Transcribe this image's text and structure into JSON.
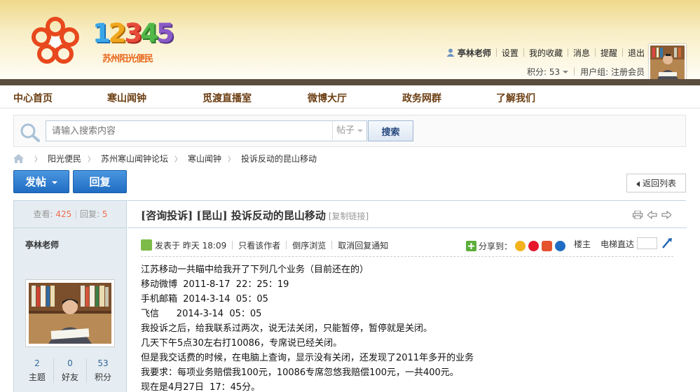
{
  "header": {
    "logo_number": "12345",
    "logo_subtitle": "苏州阳光便民",
    "user": {
      "name": "亭林老师",
      "links": [
        "设置",
        "我的收藏",
        "消息",
        "提醒",
        "退出"
      ],
      "points_label": "积分: 53",
      "group_label": "用户组: 注册会员"
    }
  },
  "nav": {
    "items": [
      "中心首页",
      "寒山闻钟",
      "觅渡直播室",
      "微博大厅",
      "政务网群",
      "了解我们"
    ]
  },
  "search": {
    "placeholder": "请输入搜索内容",
    "type": "帖子",
    "button": "搜索"
  },
  "breadcrumb": [
    "阳光便民",
    "苏州寒山闻钟论坛",
    "寒山闻钟",
    "投诉反动的昆山移动"
  ],
  "actions": {
    "post": "发帖",
    "reply": "回复",
    "back": "返回列表"
  },
  "post": {
    "stats": {
      "views_label": "查看:",
      "views": "425",
      "replies_label": "回复:",
      "replies": "5"
    },
    "author": "亭林老师",
    "author_stats": [
      {
        "value": "2",
        "label": "主题"
      },
      {
        "value": "0",
        "label": "好友"
      },
      {
        "value": "53",
        "label": "积分"
      }
    ],
    "title": "[咨询投诉] [昆山] 投诉反动的昆山移动",
    "copy_link": "[复制链接]",
    "meta": {
      "posted": "发表于 昨天 18:09",
      "links": [
        "只看该作者",
        "倒序浏览",
        "取消回复通知"
      ]
    },
    "share_label": "分享到：",
    "floor": "楼主",
    "jump": "电梯直达",
    "content": [
      "江苏移动一共瞄中给我开了下列几个业务（目前还在的）",
      "移动微博  2011-8-17  22：25：19",
      "手机邮箱  2014-3-14  05：05",
      "飞信      2014-3-14  05：05",
      "我投诉之后，给我联系过两次，说无法关闭，只能暂停，暂停就是关闭。",
      "几天下午5点30左右打10086，专席说已经关闭。",
      "但是我交话费的时候，在电脑上查询，显示没有关闭，还发现了2011年多开的业务",
      "我要求：每项业务赔偿我100元，10086专席忽悠我赔偿100元，一共400元。",
      "现在是4月27日  17：45分。"
    ]
  },
  "colors": {
    "nav_text": "#6b3e12",
    "button_blue": "#1f6cc3",
    "accent_red": "#f26c4f",
    "border_blue": "#c2d5e3"
  }
}
